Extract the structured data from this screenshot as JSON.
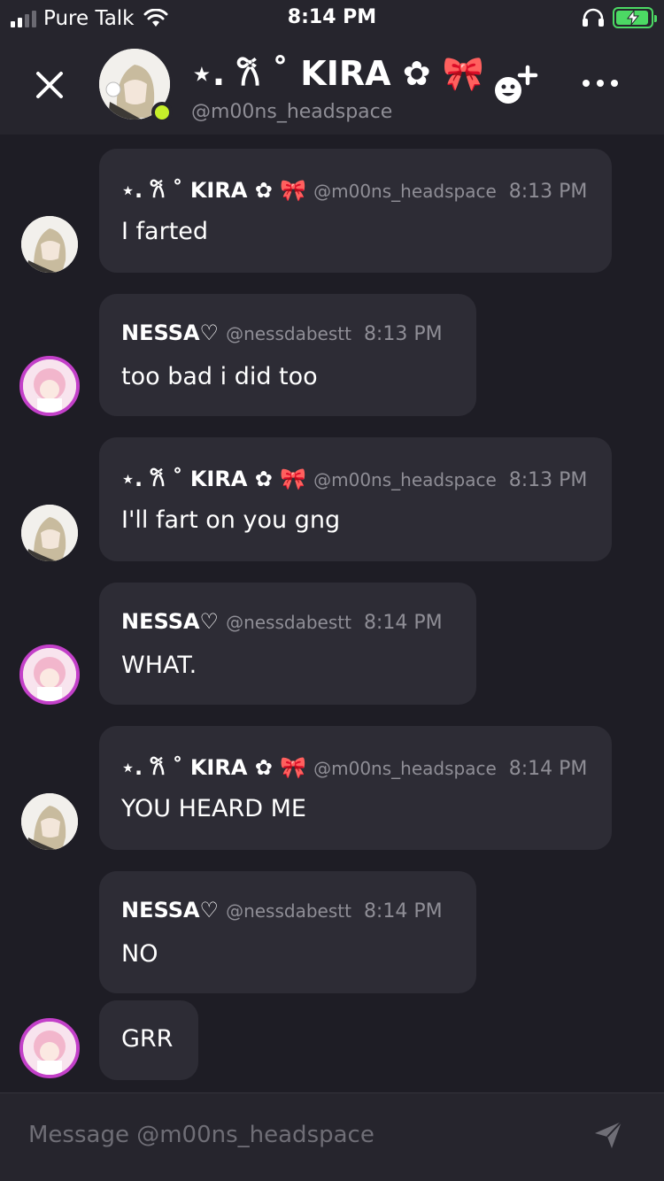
{
  "status_bar": {
    "carrier": "Pure Talk",
    "time": "8:14 PM",
    "icons": [
      "signal-icon",
      "wifi-icon",
      "headphones-icon",
      "battery-charging-icon"
    ]
  },
  "header": {
    "title": "⋆. 𐙚 ˚ KIRA ✿ 🎀",
    "handle": "@m00ns_headspace",
    "online": true,
    "icons": [
      "close-icon",
      "add-friend-icon",
      "more-icon"
    ]
  },
  "messages": [
    {
      "author": "⋆. 𐙚 ˚ KIRA ✿ 🎀",
      "handle": "@m00ns_headspace",
      "time": "8:13 PM",
      "text": "I farted"
    },
    {
      "author": "NESSA♡",
      "handle": "@nessdabestt",
      "time": "8:13 PM",
      "text": "too bad i did too"
    },
    {
      "author": "⋆. 𐙚 ˚ KIRA ✿ 🎀",
      "handle": "@m00ns_headspace",
      "time": "8:13 PM",
      "text": "I'll fart on you gng"
    },
    {
      "author": "NESSA♡",
      "handle": "@nessdabestt",
      "time": "8:14 PM",
      "text": "WHAT."
    },
    {
      "author": "⋆. 𐙚 ˚ KIRA ✿ 🎀",
      "handle": "@m00ns_headspace",
      "time": "8:14 PM",
      "text": "YOU HEARD ME"
    },
    {
      "author": "NESSA♡",
      "handle": "@nessdabestt",
      "time": "8:14 PM",
      "text": "NO"
    },
    {
      "text": "GRR"
    }
  ],
  "composer": {
    "placeholder": "Message @m00ns_headspace",
    "send_icon": "send-icon"
  },
  "colors": {
    "background": "#1e1d25",
    "header": "#26252d",
    "bubble": "#2d2c35",
    "muted": "#8f8e96",
    "online": "#c6ef2a",
    "battery": "#4cd964"
  }
}
